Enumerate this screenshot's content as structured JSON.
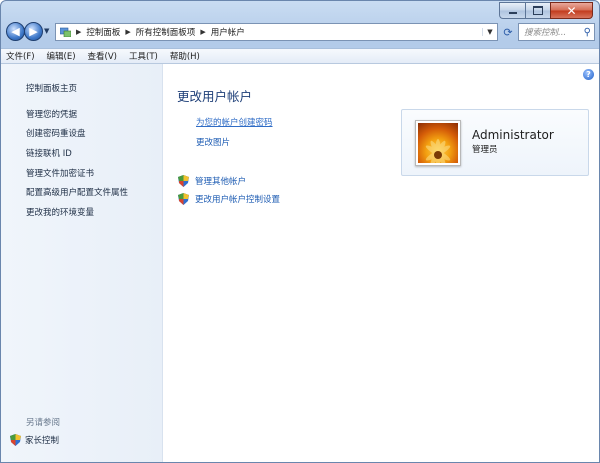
{
  "address_bar": {
    "crumbs": [
      "控制面板",
      "所有控制面板项",
      "用户帐户"
    ]
  },
  "search": {
    "placeholder": "搜索控制..."
  },
  "menu": [
    "文件(F)",
    "编辑(E)",
    "查看(V)",
    "工具(T)",
    "帮助(H)"
  ],
  "sidebar": {
    "items": [
      "控制面板主页",
      "管理您的凭据",
      "创建密码重设盘",
      "链接联机 ID",
      "管理文件加密证书",
      "配置高级用户配置文件属性",
      "更改我的环境变量"
    ],
    "see_also": "另请参阅",
    "parental": "家长控制"
  },
  "main": {
    "title": "更改用户帐户",
    "links": [
      "为您的帐户创建密码",
      "更改图片"
    ],
    "shield_links": [
      "管理其他帐户",
      "更改用户帐户控制设置"
    ],
    "help_glyph": "?"
  },
  "account": {
    "name": "Administrator",
    "role": "管理员"
  },
  "colors": {
    "link": "#1e5cb3",
    "title": "#1e3f78"
  }
}
